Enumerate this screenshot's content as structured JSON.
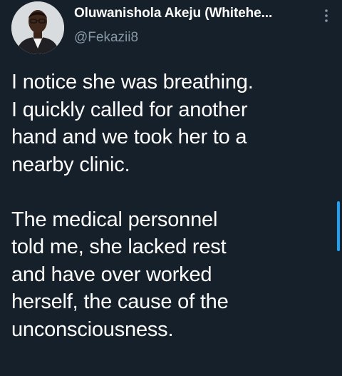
{
  "tweet": {
    "author": {
      "display_name": "Oluwanishola Akeju (Whitehe...",
      "handle": "@Fekazii8"
    },
    "paragraphs": [
      "I notice she was breathing.\nI quickly called for another\nhand and we took her to a\nnearby clinic.",
      "The medical personnel\ntold me, she lacked rest\nand have over worked\nherself, the cause of the\nunconsciousness."
    ],
    "icons": {
      "more": "more-vertical-icon"
    }
  },
  "colors": {
    "background": "#15202b",
    "text": "#ffffff",
    "secondary_text": "#8899a6",
    "accent": "#1da1f2"
  }
}
